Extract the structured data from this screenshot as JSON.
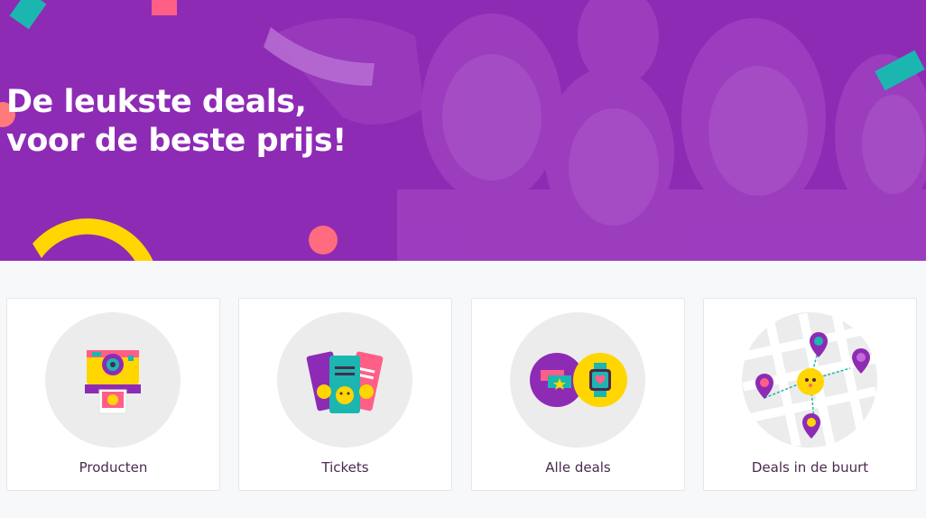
{
  "hero": {
    "title": "De leukste deals,\nvoor de beste prijs!"
  },
  "categories": [
    {
      "label": "Producten",
      "icon": "instant-camera-icon"
    },
    {
      "label": "Tickets",
      "icon": "tickets-icon"
    },
    {
      "label": "Alle deals",
      "icon": "all-deals-icon"
    },
    {
      "label": "Deals in de buurt",
      "icon": "map-pins-icon"
    }
  ],
  "colors": {
    "brand_purple": "#8e2bb5",
    "label_text": "#4a2a4e",
    "card_border": "#e6e6ea",
    "circle_bg": "#ececec",
    "yellow": "#ffd600",
    "teal": "#1bb6b0",
    "pink": "#ff5f86"
  }
}
